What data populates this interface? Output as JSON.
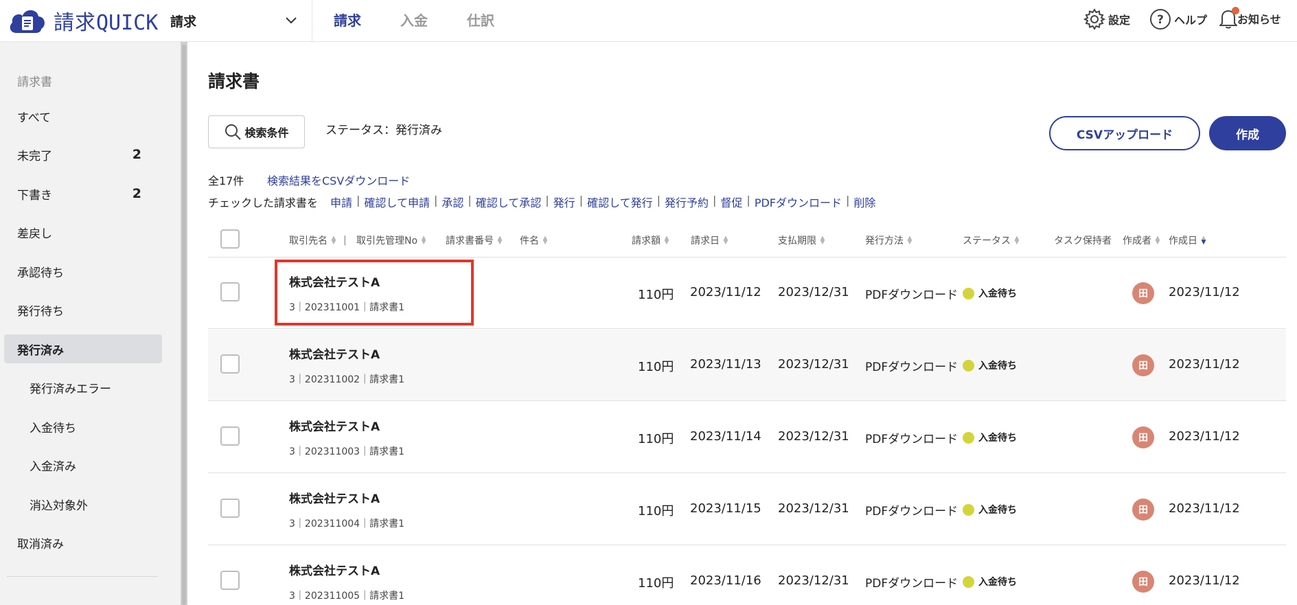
{
  "app": {
    "logo_text_jp": "請求",
    "logo_text_en": "QUICK",
    "selected_app": "請求"
  },
  "nav": {
    "tabs": [
      "請求",
      "入金",
      "仕訳"
    ],
    "active": 0
  },
  "top_right": {
    "settings": "設定",
    "help": "ヘルプ",
    "notifications": "お知らせ"
  },
  "sidebar": {
    "heading": "請求書",
    "items": [
      {
        "label": "すべて",
        "count": ""
      },
      {
        "label": "未完了",
        "count": "2"
      },
      {
        "label": "下書き",
        "count": "2"
      },
      {
        "label": "差戻し",
        "count": ""
      },
      {
        "label": "承認待ち",
        "count": ""
      },
      {
        "label": "発行待ち",
        "count": ""
      },
      {
        "label": "発行済み",
        "count": ""
      },
      {
        "label": "発行済みエラー",
        "count": ""
      },
      {
        "label": "入金待ち",
        "count": ""
      },
      {
        "label": "入金済み",
        "count": ""
      },
      {
        "label": "消込対象外",
        "count": ""
      },
      {
        "label": "取消済み",
        "count": ""
      }
    ]
  },
  "main": {
    "title": "請求書",
    "search_button": "検索条件",
    "status_filter": "ステータス：発行済み",
    "csv_upload_button": "CSVアップロード",
    "create_button": "作成",
    "total_count": "全17件",
    "csv_download_link": "検索結果をCSVダウンロード",
    "bulk_label": "チェックした請求書を",
    "bulk_actions": [
      "申請",
      "確認して申請",
      "承認",
      "確認して承認",
      "発行",
      "確認して発行",
      "発行予約",
      "督促",
      "PDFダウンロード",
      "削除"
    ]
  },
  "table": {
    "columns": [
      "取引先名",
      "取引先管理No",
      "請求書番号",
      "件名",
      "請求額",
      "請求日",
      "支払期限",
      "発行方法",
      "ステータス",
      "タスク保持者",
      "作成者",
      "作成日"
    ],
    "rows": [
      {
        "company": "株式会社テストA",
        "sub": "3｜202311001｜請求書1",
        "amount": "110円",
        "invoice_date": "2023/11/12",
        "due_date": "2023/12/31",
        "method": "PDFダウンロード",
        "status": "入金待ち",
        "creator": "田",
        "created": "2023/11/12"
      },
      {
        "company": "株式会社テストA",
        "sub": "3｜202311002｜請求書1",
        "amount": "110円",
        "invoice_date": "2023/11/13",
        "due_date": "2023/12/31",
        "method": "PDFダウンロード",
        "status": "入金待ち",
        "creator": "田",
        "created": "2023/11/12"
      },
      {
        "company": "株式会社テストA",
        "sub": "3｜202311003｜請求書1",
        "amount": "110円",
        "invoice_date": "2023/11/14",
        "due_date": "2023/12/31",
        "method": "PDFダウンロード",
        "status": "入金待ち",
        "creator": "田",
        "created": "2023/11/12"
      },
      {
        "company": "株式会社テストA",
        "sub": "3｜202311004｜請求書1",
        "amount": "110円",
        "invoice_date": "2023/11/15",
        "due_date": "2023/12/31",
        "method": "PDFダウンロード",
        "status": "入金待ち",
        "creator": "田",
        "created": "2023/11/12"
      },
      {
        "company": "株式会社テストA",
        "sub": "3｜202311005｜請求書1",
        "amount": "110円",
        "invoice_date": "2023/11/16",
        "due_date": "2023/12/31",
        "method": "PDFダウンロード",
        "status": "入金待ち",
        "creator": "田",
        "created": "2023/11/12"
      }
    ]
  },
  "colors": {
    "brand": "#2f3f9e",
    "status_dot": "#d4d43a",
    "avatar": "#d98573",
    "highlight": "#e3362b"
  }
}
